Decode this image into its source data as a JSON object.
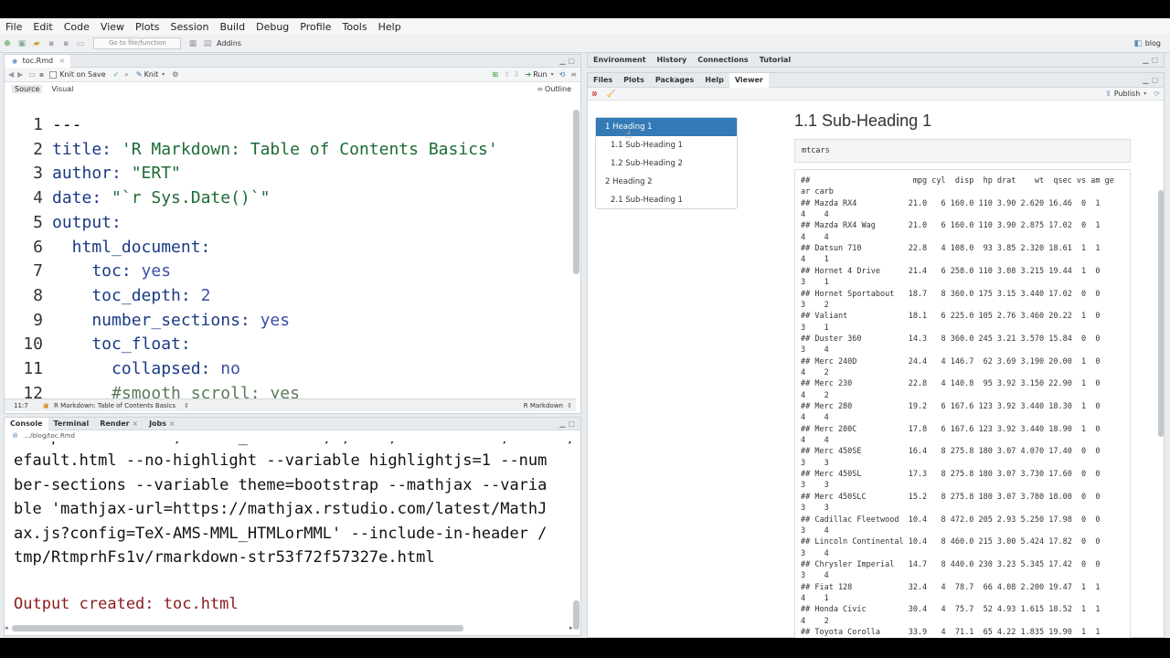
{
  "menu": [
    "File",
    "Edit",
    "Code",
    "View",
    "Plots",
    "Session",
    "Build",
    "Debug",
    "Profile",
    "Tools",
    "Help"
  ],
  "toolbar": {
    "goto_placeholder": "Go to file/function",
    "addins": "Addins",
    "project": "blog"
  },
  "editor": {
    "tab": "toc.Rmd",
    "knit_on_save": "Knit on Save",
    "knit": "Knit",
    "run": "Run",
    "source_tab": "Source",
    "visual_tab": "Visual",
    "outline": "Outline",
    "lines": [
      {
        "n": "1",
        "t": "---"
      },
      {
        "n": "2",
        "t": "title: 'R Markdown: Table of Contents Basics'"
      },
      {
        "n": "3",
        "t": "author: \"ERT\""
      },
      {
        "n": "4",
        "t": "date: \"`r Sys.Date()`\""
      },
      {
        "n": "5",
        "t": "output:"
      },
      {
        "n": "6",
        "t": "  html_document:"
      },
      {
        "n": "7",
        "t": "    toc: yes"
      },
      {
        "n": "8",
        "t": "    toc_depth: 2"
      },
      {
        "n": "9",
        "t": "    number_sections: yes"
      },
      {
        "n": "10",
        "t": "    toc_float:"
      },
      {
        "n": "11",
        "t": "      collapsed: no"
      },
      {
        "n": "12",
        "t": "      #smooth_scroll: yes"
      }
    ],
    "status_pos": "11:7",
    "status_section": "R Markdown: Table of Contents Basics",
    "status_mode": "R Markdown"
  },
  "console": {
    "tabs": [
      "Console",
      "Terminal",
      "Render",
      "Jobs"
    ],
    "path": ".../blog/toc.Rmd",
    "lines": [
      "efault.html --no-highlight --variable highlightjs=1 --num",
      "ber-sections --variable theme=bootstrap --mathjax --varia",
      "ble 'mathjax-url=https://mathjax.rstudio.com/latest/MathJ",
      "ax.js?config=TeX-AMS-MML_HTMLorMML' --include-in-header /",
      "tmp/RtmprhFs1v/rmarkdown-str53f72f57327e.html"
    ],
    "output": "Output created: toc.html"
  },
  "env_tabs": [
    "Environment",
    "History",
    "Connections",
    "Tutorial"
  ],
  "files_tabs": [
    "Files",
    "Plots",
    "Packages",
    "Help",
    "Viewer"
  ],
  "publish": "Publish",
  "viewer": {
    "toc": [
      {
        "label": "1 Heading 1",
        "sub": false,
        "active": true
      },
      {
        "label": "1.1 Sub-Heading 1",
        "sub": true,
        "active": false
      },
      {
        "label": "1.2 Sub-Heading 2",
        "sub": true,
        "active": false
      },
      {
        "label": "2 Heading 2",
        "sub": false,
        "active": false
      },
      {
        "label": "2.1 Sub-Heading 1",
        "sub": true,
        "active": false
      }
    ],
    "heading": "1.1 Sub-Heading 1",
    "code": "mtcars",
    "output": [
      "##                      mpg cyl  disp  hp drat    wt  qsec vs am ge",
      "ar carb",
      "## Mazda RX4           21.0   6 160.0 110 3.90 2.620 16.46  0  1",
      "4    4",
      "## Mazda RX4 Wag       21.0   6 160.0 110 3.90 2.875 17.02  0  1",
      "4    4",
      "## Datsun 710          22.8   4 108.0  93 3.85 2.320 18.61  1  1",
      "4    1",
      "## Hornet 4 Drive      21.4   6 258.0 110 3.08 3.215 19.44  1  0",
      "3    1",
      "## Hornet Sportabout   18.7   8 360.0 175 3.15 3.440 17.02  0  0",
      "3    2",
      "## Valiant             18.1   6 225.0 105 2.76 3.460 20.22  1  0",
      "3    1",
      "## Duster 360          14.3   8 360.0 245 3.21 3.570 15.84  0  0",
      "3    4",
      "## Merc 240D           24.4   4 146.7  62 3.69 3.190 20.00  1  0",
      "4    2",
      "## Merc 230            22.8   4 140.8  95 3.92 3.150 22.90  1  0",
      "4    2",
      "## Merc 280            19.2   6 167.6 123 3.92 3.440 18.30  1  0",
      "4    4",
      "## Merc 280C           17.8   6 167.6 123 3.92 3.440 18.90  1  0",
      "4    4",
      "## Merc 450SE          16.4   8 275.8 180 3.07 4.070 17.40  0  0",
      "3    3",
      "## Merc 450SL          17.3   8 275.8 180 3.07 3.730 17.60  0  0",
      "3    3",
      "## Merc 450SLC         15.2   8 275.8 180 3.07 3.780 18.00  0  0",
      "3    3",
      "## Cadillac Fleetwood  10.4   8 472.0 205 2.93 5.250 17.98  0  0",
      "3    4",
      "## Lincoln Continental 10.4   8 460.0 215 3.00 5.424 17.82  0  0",
      "3    4",
      "## Chrysler Imperial   14.7   8 440.0 230 3.23 5.345 17.42  0  0",
      "3    4",
      "## Fiat 128            32.4   4  78.7  66 4.08 2.200 19.47  1  1",
      "4    1",
      "## Honda Civic         30.4   4  75.7  52 4.93 1.615 18.52  1  1",
      "4    2",
      "## Toyota Corolla      33.9   4  71.1  65 4.22 1.835 19.90  1  1"
    ]
  }
}
